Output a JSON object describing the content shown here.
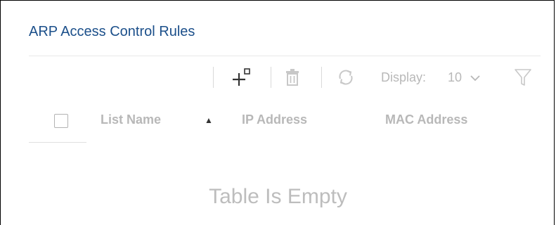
{
  "panel": {
    "title": "ARP Access Control Rules"
  },
  "toolbar": {
    "add_icon": "add-icon",
    "delete_icon": "trash-icon",
    "refresh_icon": "refresh-icon",
    "display_label": "Display:",
    "display_value": "10",
    "dropdown_icon": "chevron-down-icon",
    "filter_icon": "filter-icon"
  },
  "table": {
    "columns": [
      "List Name",
      "IP Address",
      "MAC Address"
    ],
    "sort_indicator": "▲",
    "sorted_column": "List Name",
    "empty_message": "Table Is Empty"
  },
  "colors": {
    "title": "#1b4f8a",
    "muted": "#b8b8b8",
    "icon_dark": "#333333"
  }
}
